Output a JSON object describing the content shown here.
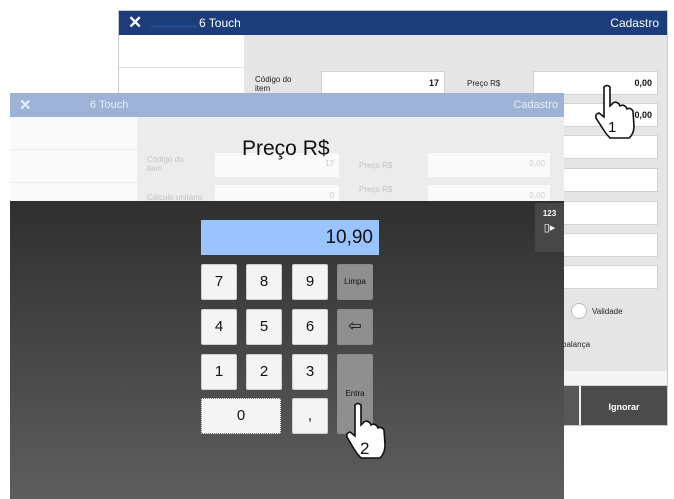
{
  "back_window": {
    "close_glyph": "✕",
    "app_title": "6 Touch",
    "right_title": "Cadastro",
    "codigo_label": "Código do item",
    "codigo_value": "17",
    "preco_label": "Preço R$",
    "preco_value": "0,00",
    "field2_value": "0,00",
    "validade_label": "Validade",
    "balanca_label": "balança",
    "ignorar_label": "Ignorar"
  },
  "front_window": {
    "close_glyph": "✕",
    "app_title": "6 Touch",
    "right_title": "Cadastro",
    "heading": "Preço R$",
    "ghost_codigo_label": "Código do item",
    "ghost_codigo_value": "17",
    "ghost_preco_label": "Preço R$",
    "ghost_preco_value": "0,00",
    "ghost_row2_label": "Preço R$",
    "ghost_row2_value": "0",
    "ghost_row2_right": "0,00",
    "ghost_row2_left_label": "Cálculo unitário"
  },
  "keypad": {
    "display_value": "10,90",
    "keys": {
      "k7": "7",
      "k8": "8",
      "k9": "9",
      "k4": "4",
      "k5": "5",
      "k6": "6",
      "k1": "1",
      "k2": "2",
      "k3": "3",
      "k0": "0",
      "comma": ","
    },
    "limpa_label": "Limpa",
    "entra_label": "Entra",
    "backspace_icon": "⇦",
    "side_tab_label": "123",
    "side_tab_icon": "keyboard-toggle-icon"
  },
  "cursors": {
    "step1": "1",
    "step2": "2"
  },
  "colors": {
    "titlebar": "#1c3d7a",
    "display": "#99c4ff",
    "keypad_bg": "#3d3d3d"
  }
}
